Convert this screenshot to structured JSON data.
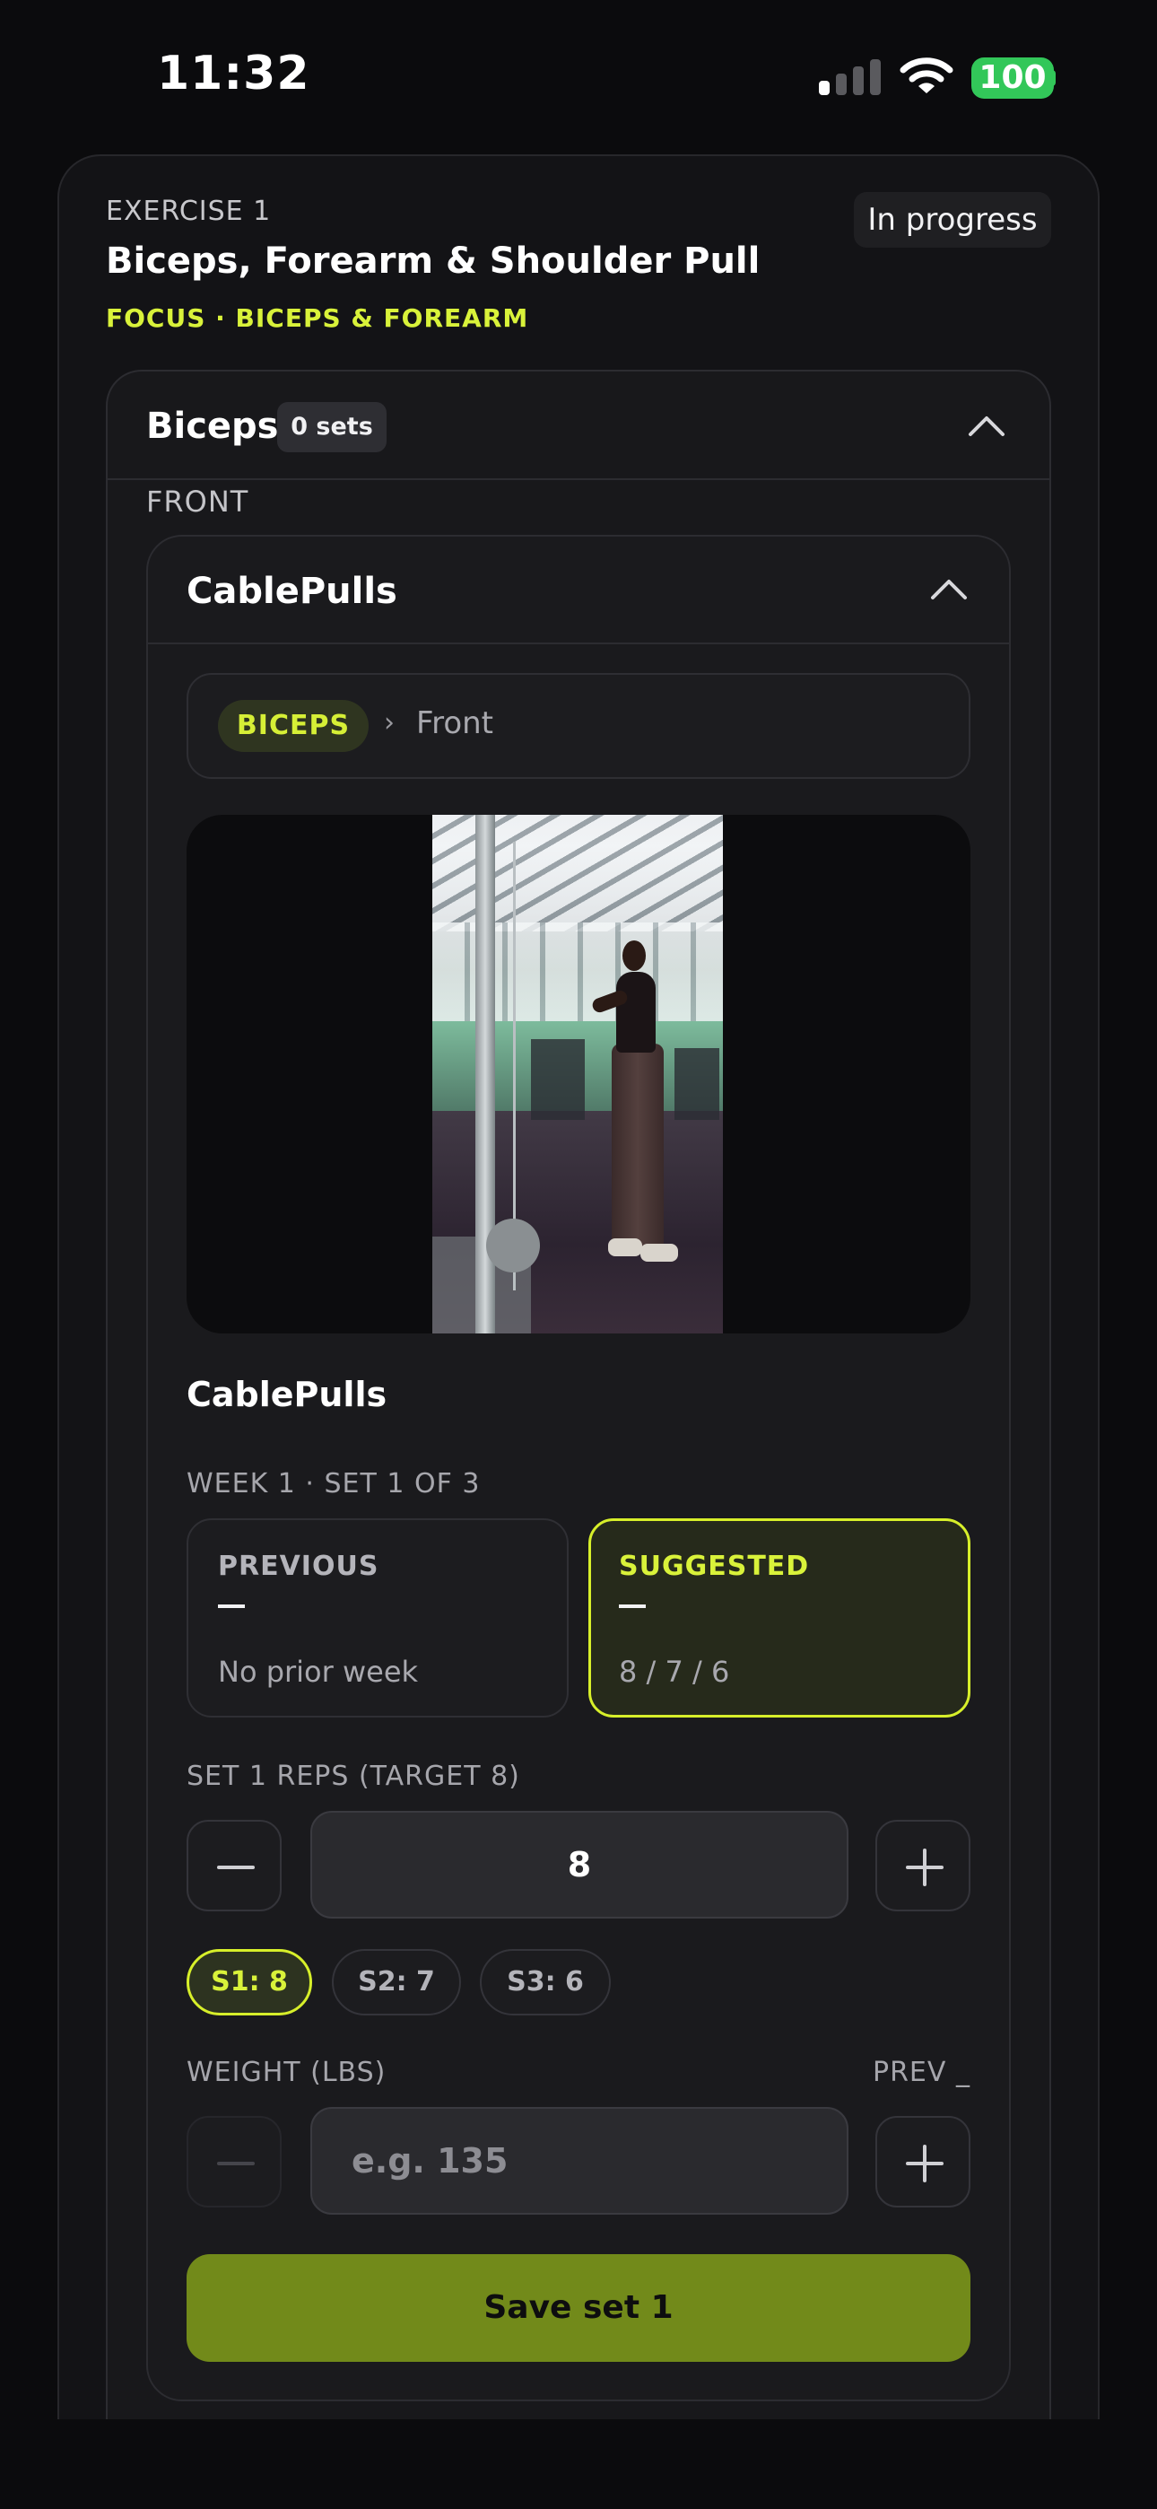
{
  "status_bar": {
    "time": "11:32",
    "battery": "100"
  },
  "exercise": {
    "label": "EXERCISE 1",
    "title": "Biceps, Forearm & Shoulder Pull",
    "focus": "FOCUS · BICEPS & FOREARM",
    "status": "In progress"
  },
  "muscle_group": {
    "name": "Biceps",
    "sets_badge": "0 sets",
    "section": "FRONT"
  },
  "movement": {
    "name": "CablePulls",
    "breadcrumb_tag": "BICEPS",
    "breadcrumb_sep": "›",
    "breadcrumb_location": "Front",
    "subtitle": "CablePulls",
    "week_label": "WEEK 1 · SET 1 OF 3"
  },
  "previous": {
    "title": "PREVIOUS",
    "text": "No prior week"
  },
  "suggested": {
    "title": "SUGGESTED",
    "text": "8 / 7 / 6"
  },
  "reps": {
    "label": "SET 1 REPS (TARGET 8)",
    "value": "8",
    "chips": [
      "S1: 8",
      "S2: 7",
      "S3: 6"
    ]
  },
  "weight": {
    "label": "WEIGHT (LBS)",
    "prev": "PREV _",
    "placeholder": "e.g. 135"
  },
  "save_button": "Save set 1",
  "colors": {
    "accent": "#d7ef2a",
    "save": "#728a1a",
    "background": "#0b0b0d"
  },
  "icons": [
    "signal-icon",
    "wifi-icon",
    "battery-icon",
    "chevron-up-icon",
    "minus-icon",
    "plus-icon"
  ]
}
